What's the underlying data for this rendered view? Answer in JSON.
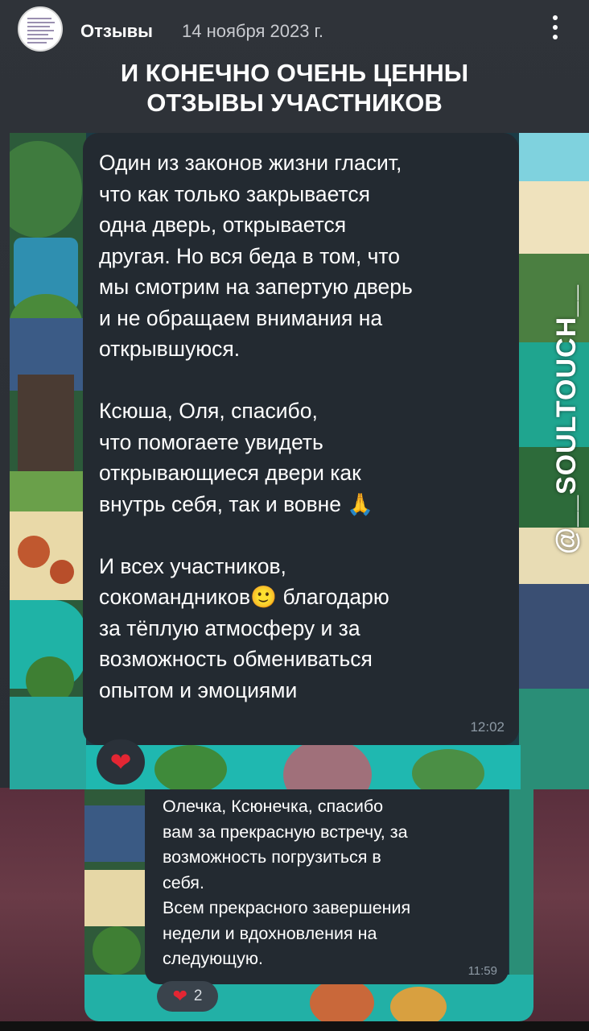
{
  "header": {
    "channel_name": "Отзывы",
    "date": "14 ноября 2023 г.",
    "menu_icon": "more-vertical-icon"
  },
  "headline": "И КОНЕЧНО ОЧЕНЬ ЦЕННЫ\nОТЗЫВЫ УЧАСТНИКОВ",
  "watermark": "@__SOULTOUCH__",
  "review1": {
    "text": "Один из законов жизни гласит,\nчто как только закрывается\nодна дверь, открывается\nдругая. Но вся беда в том, что\nмы смотрим на запертую дверь\nи не обращаем внимания на\nоткрывшуюся.\n\nКсюша, Оля, спасибо,\nчто помогаете увидеть\nоткрывающиеся двери как\nвнутрь себя, так и вовне 🙏\n\nИ всех участников,\nсокомандников🙂 благодарю\nза тёплую атмосферу и за\nвозможность обмениваться\nопытом и эмоциями",
    "time": "12:02",
    "reaction": "❤"
  },
  "review2": {
    "text": "Олечка, Ксюнечка, спасибо\nвам за прекрасную встречу, за\nвозможность погрузиться в\nсебя.\nВсем прекрасного завершения\nнедели и вдохновления на\nследующую.",
    "time": "11:59",
    "reaction": "❤",
    "reaction_count": "2"
  },
  "colors": {
    "bubble": "#232a31",
    "reaction_heart": "#e32633",
    "story_background_bottom": "#6a3b47"
  }
}
